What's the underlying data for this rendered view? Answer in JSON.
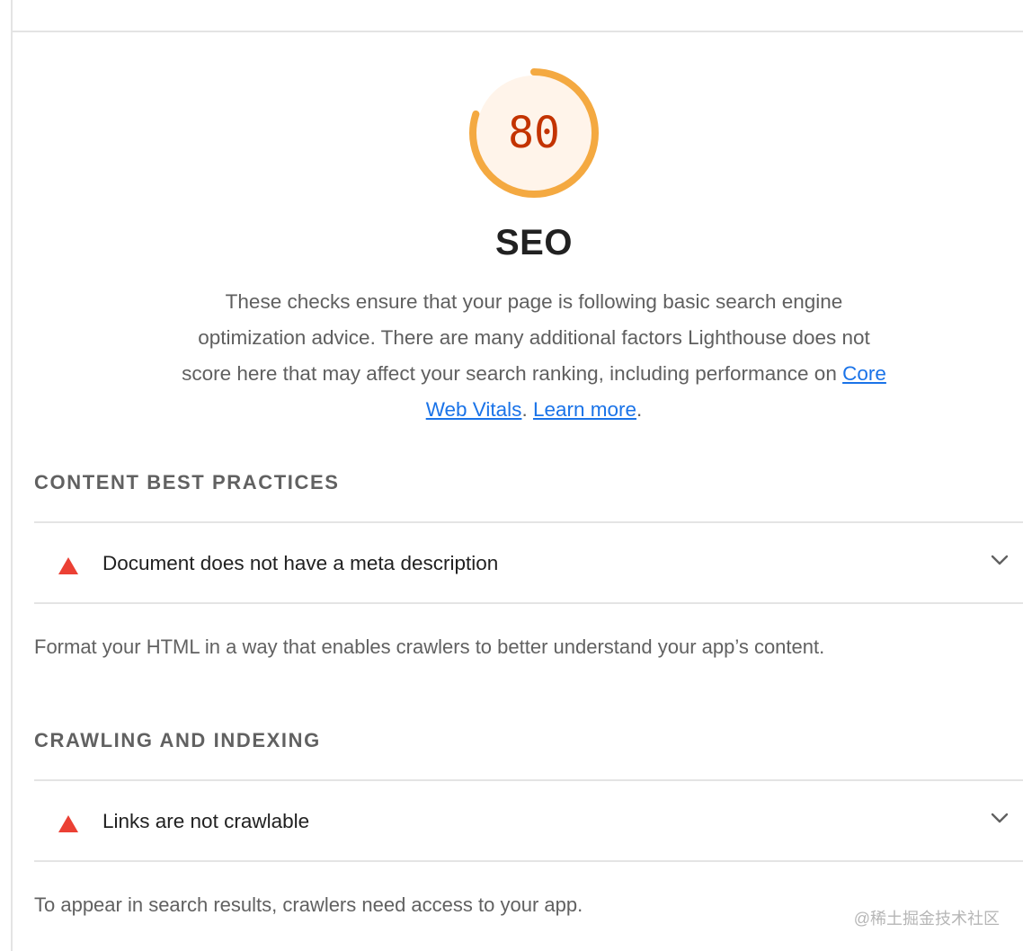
{
  "category": {
    "score": "80",
    "score_fraction": 0.8,
    "title": "SEO",
    "description_text": "These checks ensure that your page is following basic search engine optimization advice. There are many additional factors Lighthouse does not score here that may affect your search ranking, including performance on",
    "link_core_web_vitals": "Core Web Vitals",
    "separator": ".",
    "link_learn_more": "Learn more",
    "end_period": "."
  },
  "colors": {
    "gauge_ring": "#f4a941",
    "gauge_fill": "#fff4ea",
    "gauge_text": "#c33300",
    "fail": "#eb4034",
    "link": "#1a73e8"
  },
  "groups": [
    {
      "title": "CONTENT BEST PRACTICES",
      "audits": [
        {
          "title": "Document does not have a meta description",
          "status_icon": "fail-triangle-icon"
        }
      ],
      "description": "Format your HTML in a way that enables crawlers to better understand your app’s content."
    },
    {
      "title": "CRAWLING AND INDEXING",
      "audits": [
        {
          "title": "Links are not crawlable",
          "status_icon": "fail-triangle-icon"
        }
      ],
      "description": "To appear in search results, crawlers need access to your app."
    }
  ],
  "watermark": "@稀土掘金技术社区"
}
